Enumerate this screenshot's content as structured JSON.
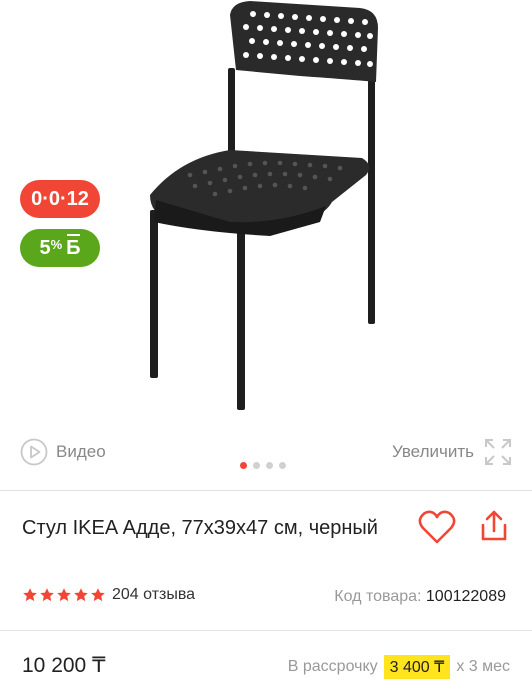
{
  "gallery": {
    "image_alt": "",
    "badge_installment": "0·0·12",
    "badge_bonus_percent": "5",
    "badge_bonus_pct_sign": "%",
    "badge_bonus_letter": "Б",
    "video_label": "Видео",
    "zoom_label": "Увеличить",
    "pagination": {
      "count": 4,
      "active": 1
    },
    "icons": [
      "play-circle-icon",
      "expand-icon"
    ]
  },
  "product": {
    "title": "Стул IKEA Адде, 77x39x47 см, черный",
    "rating_stars": 5,
    "reviews": "204 отзыва",
    "code_label": "Код товара:",
    "code_value": "100122089"
  },
  "pricing": {
    "price": "10 200 ₸",
    "installment_prefix": "В рассрочку",
    "installment_amount": "3 400 ₸",
    "installment_suffix": "х 3 мес"
  },
  "colors": {
    "accent_red": "#f14635",
    "bonus_green": "#5aa71c",
    "highlight_yellow": "#ffe41e",
    "star_red": "#f14635"
  }
}
